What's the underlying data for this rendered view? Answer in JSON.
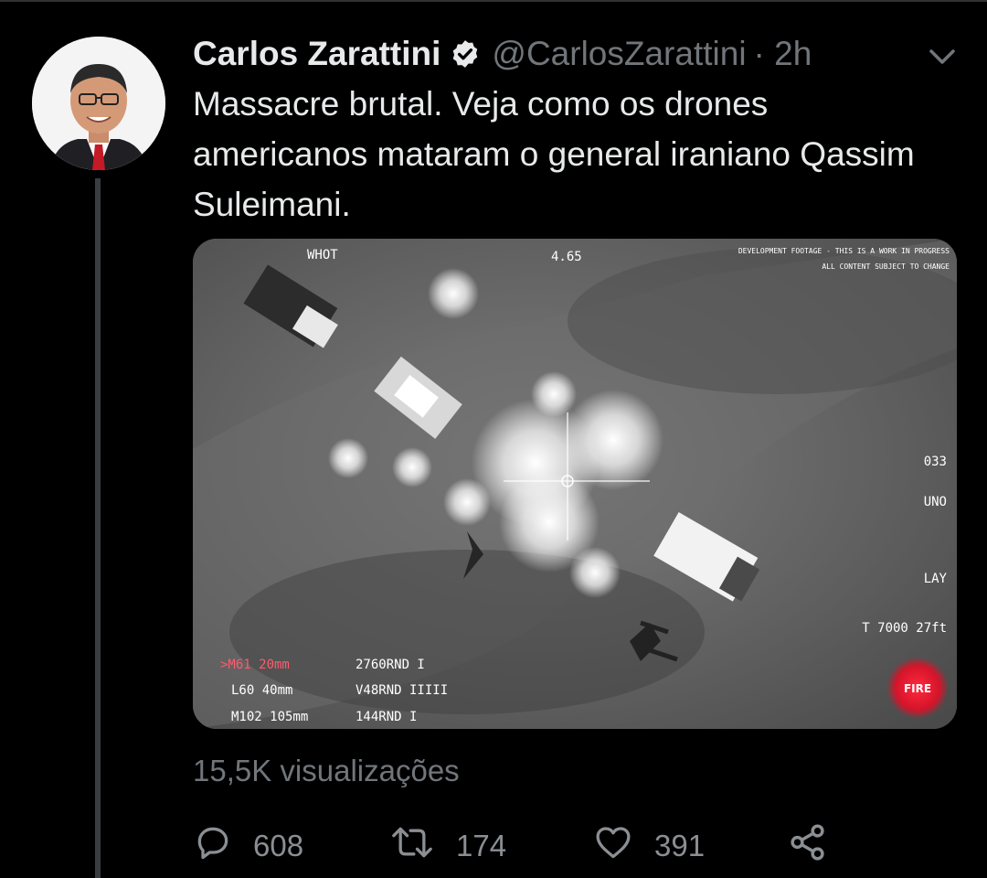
{
  "tweet": {
    "author_name": "Carlos Zarattini",
    "handle": "@CarlosZarattini",
    "time": "· 2h",
    "text": "Massacre brutal. Veja como os drones americanos mataram o general iraniano Qassim Suleimani.",
    "views": "15,5K visualizações"
  },
  "media": {
    "hud_top_left": "WHOT",
    "hud_top_center": "4.65",
    "hud_top_right_1": "DEVELOPMENT FOOTAGE - THIS IS A WORK IN PROGRESS",
    "hud_top_right_2": "ALL CONTENT SUBJECT TO CHANGE",
    "hud_right_1": "033",
    "hud_right_2": "UNO",
    "hud_right_3": "LAY",
    "hud_right_4": "T 7000 27ft",
    "weapons": [
      {
        "name": ">M61 20mm",
        "rounds": "2760RND I"
      },
      {
        "name": "L60 40mm",
        "rounds": "V48RND IIIII"
      },
      {
        "name": "M102 105mm",
        "rounds": "144RND I"
      }
    ],
    "fire_badge": "FIRE"
  },
  "actions": {
    "replies": "608",
    "retweets": "174",
    "likes": "391"
  },
  "colors": {
    "background": "#000000",
    "text": "#e7e9ea",
    "secondary": "#71767b",
    "verified": "#e7e9ea",
    "fire": "#d5142a"
  }
}
